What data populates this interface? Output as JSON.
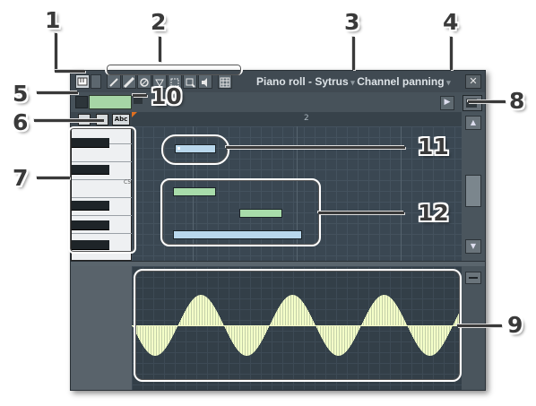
{
  "window": {
    "title": "Piano roll - Sytrus",
    "channel_target": "Channel panning",
    "close_glyph": "✕",
    "ruler_bar": "2",
    "key_label": "C5"
  },
  "callouts": [
    "1",
    "2",
    "3",
    "4",
    "5",
    "6",
    "7",
    "8",
    "9",
    "10",
    "11",
    "12"
  ],
  "toolbar_icons": [
    "piano-roll-menu-icon",
    "draw-tool-icon",
    "paint-tool-icon",
    "delete-tool-icon",
    "mute-tool-icon",
    "slice-tool-icon",
    "select-tool-icon",
    "zoom-tool-icon",
    "playback-tool-icon",
    "snap-grid-icon"
  ],
  "note_selector_icons": [
    "note-list-icon",
    "note-properties-icon",
    "abc-note-names-icon"
  ],
  "colors": {
    "note_selected": "#b9d7ec",
    "note_default": "#a8dcaa",
    "event_fill": "#f4ffc8",
    "window_bg": "#4f5a63",
    "callout_text": "#3a3a3a"
  }
}
